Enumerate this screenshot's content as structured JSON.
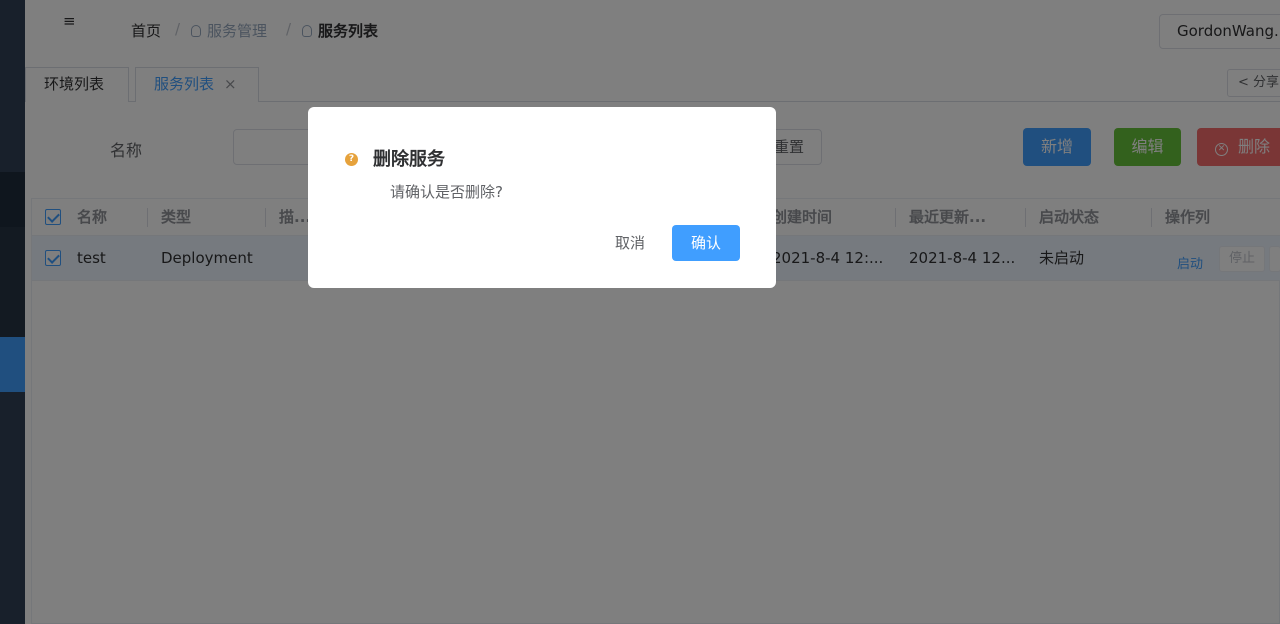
{
  "navbar": {
    "menu_icon": "hamburger-icon",
    "breadcrumb": [
      "首页",
      "服务管理",
      "服务列表"
    ],
    "separator": "/",
    "user": "GordonWang..."
  },
  "tags": {
    "items": [
      "环境列表",
      "服务列表"
    ],
    "close": "×",
    "share": "分享"
  },
  "search": {
    "name_label": "名称",
    "name_value": "",
    "reset_label": "重置"
  },
  "toolbar": {
    "add_label": "新增",
    "edit_label": "编辑",
    "delete_label": "删除"
  },
  "table": {
    "columns": [
      "名称",
      "类型",
      "描...",
      "创建时间",
      "最近更新...",
      "启动状态",
      "操作列"
    ],
    "rows": [
      {
        "checked": true,
        "name": "test",
        "type": "Deployment",
        "created": "2021-8-4 12:...",
        "updated": "2021-8-4 12...",
        "status": "未启动",
        "op_start": "启动",
        "op_stop": "停止"
      }
    ]
  },
  "dialog": {
    "icon": "?",
    "title": "删除服务",
    "message": "请确认是否删除?",
    "cancel_label": "取消",
    "confirm_label": "确认"
  },
  "colors": {
    "primary": "#409eff",
    "success": "#67c23a",
    "danger": "#f56c6c",
    "warning": "#e6a23c",
    "sidebar": "#304156"
  }
}
